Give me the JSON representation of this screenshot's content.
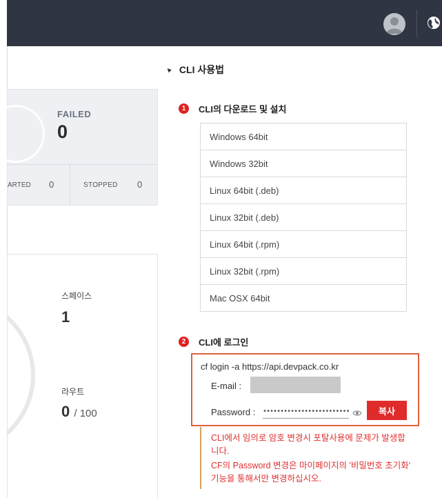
{
  "header": {
    "avatar_icon": "user-avatar-icon",
    "globe_icon": "globe-icon"
  },
  "status": {
    "failed_label": "FAILED",
    "failed_value": "0",
    "started_label": "ARTED",
    "started_value": "0",
    "stopped_label": "STOPPED",
    "stopped_value": "0"
  },
  "usage": {
    "space_label": "스페이스",
    "space_value": "1",
    "route_label": "라우트",
    "route_value": "0",
    "route_max": "/ 100"
  },
  "cli": {
    "title": "CLI 사용법",
    "step1_num": "1",
    "step1_title": "CLI의 다운로드 및 설치",
    "downloads": [
      "Windows 64bit",
      "Windows 32bit",
      "Linux 64bit (.deb)",
      "Linux 32bit (.deb)",
      "Linux 64bit (.rpm)",
      "Linux 32bit (.rpm)",
      "Mac OSX 64bit"
    ],
    "step2_num": "2",
    "step2_title": "CLI에 로그인",
    "login_command": "cf login -a https://api.devpack.co.kr",
    "email_label": "E-mail :",
    "email_value": "",
    "password_label": "Password :",
    "password_value": "••••••••••••••••••••••••••••••",
    "copy_button": "복사",
    "warning1": "CLI에서 임의로 암호 변경시 포탈사용에 문제가 발생합니다.",
    "warning2": "CF의 Password 변경은 마이페이지의 '비밀번호 초기화' 기능을 통해서만 변경하십시오."
  },
  "colors": {
    "topbar": "#2f3542",
    "accent_red": "#e02b2b",
    "box_border": "#e0603a"
  }
}
